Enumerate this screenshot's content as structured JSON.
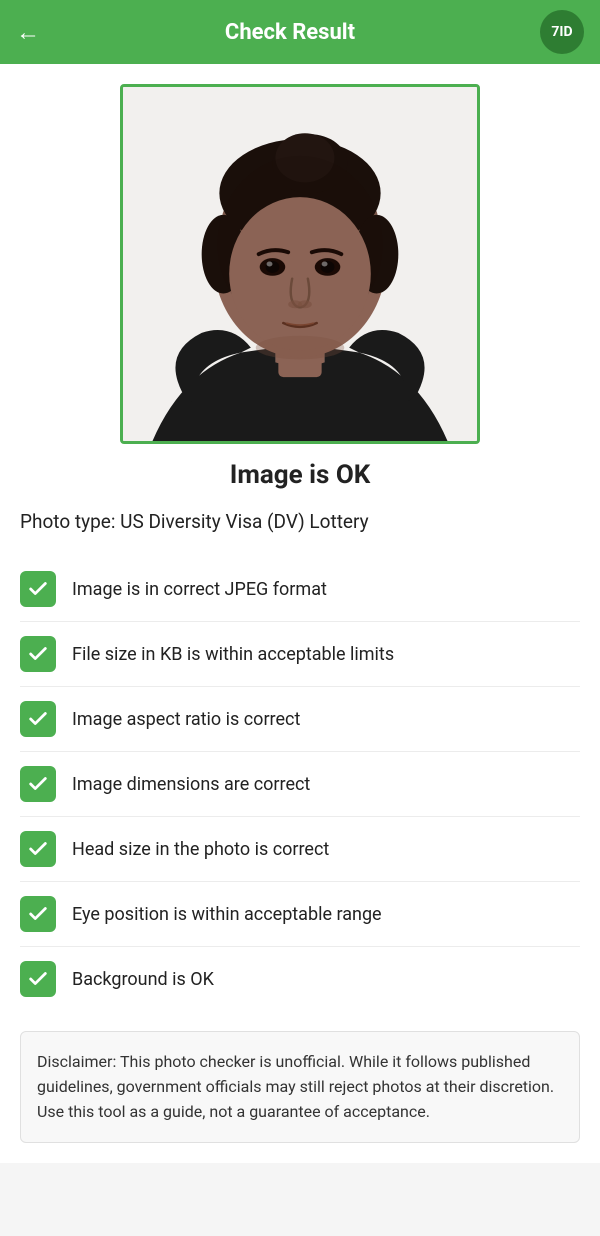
{
  "header": {
    "title": "Check Result",
    "back_label": "←",
    "logo_text": "7ID"
  },
  "photo": {
    "alt": "Passport photo of a woman"
  },
  "status": {
    "title": "Image is OK"
  },
  "photo_type_label": "Photo type: US Diversity Visa (DV) Lottery",
  "checks": [
    {
      "text": "Image is in correct JPEG format",
      "passed": true
    },
    {
      "text": "File size in KB is within acceptable limits",
      "passed": true
    },
    {
      "text": "Image aspect ratio is correct",
      "passed": true
    },
    {
      "text": "Image dimensions are correct",
      "passed": true
    },
    {
      "text": "Head size in the photo is correct",
      "passed": true
    },
    {
      "text": "Eye position is within acceptable range",
      "passed": true
    },
    {
      "text": "Background is OK",
      "passed": true
    }
  ],
  "disclaimer": {
    "text": "Disclaimer: This photo checker is unofficial. While it follows published guidelines, government officials may still reject photos at their discretion. Use this tool as a guide, not a guarantee of acceptance."
  },
  "colors": {
    "green": "#4caf50",
    "dark_green": "#2e7d32"
  }
}
